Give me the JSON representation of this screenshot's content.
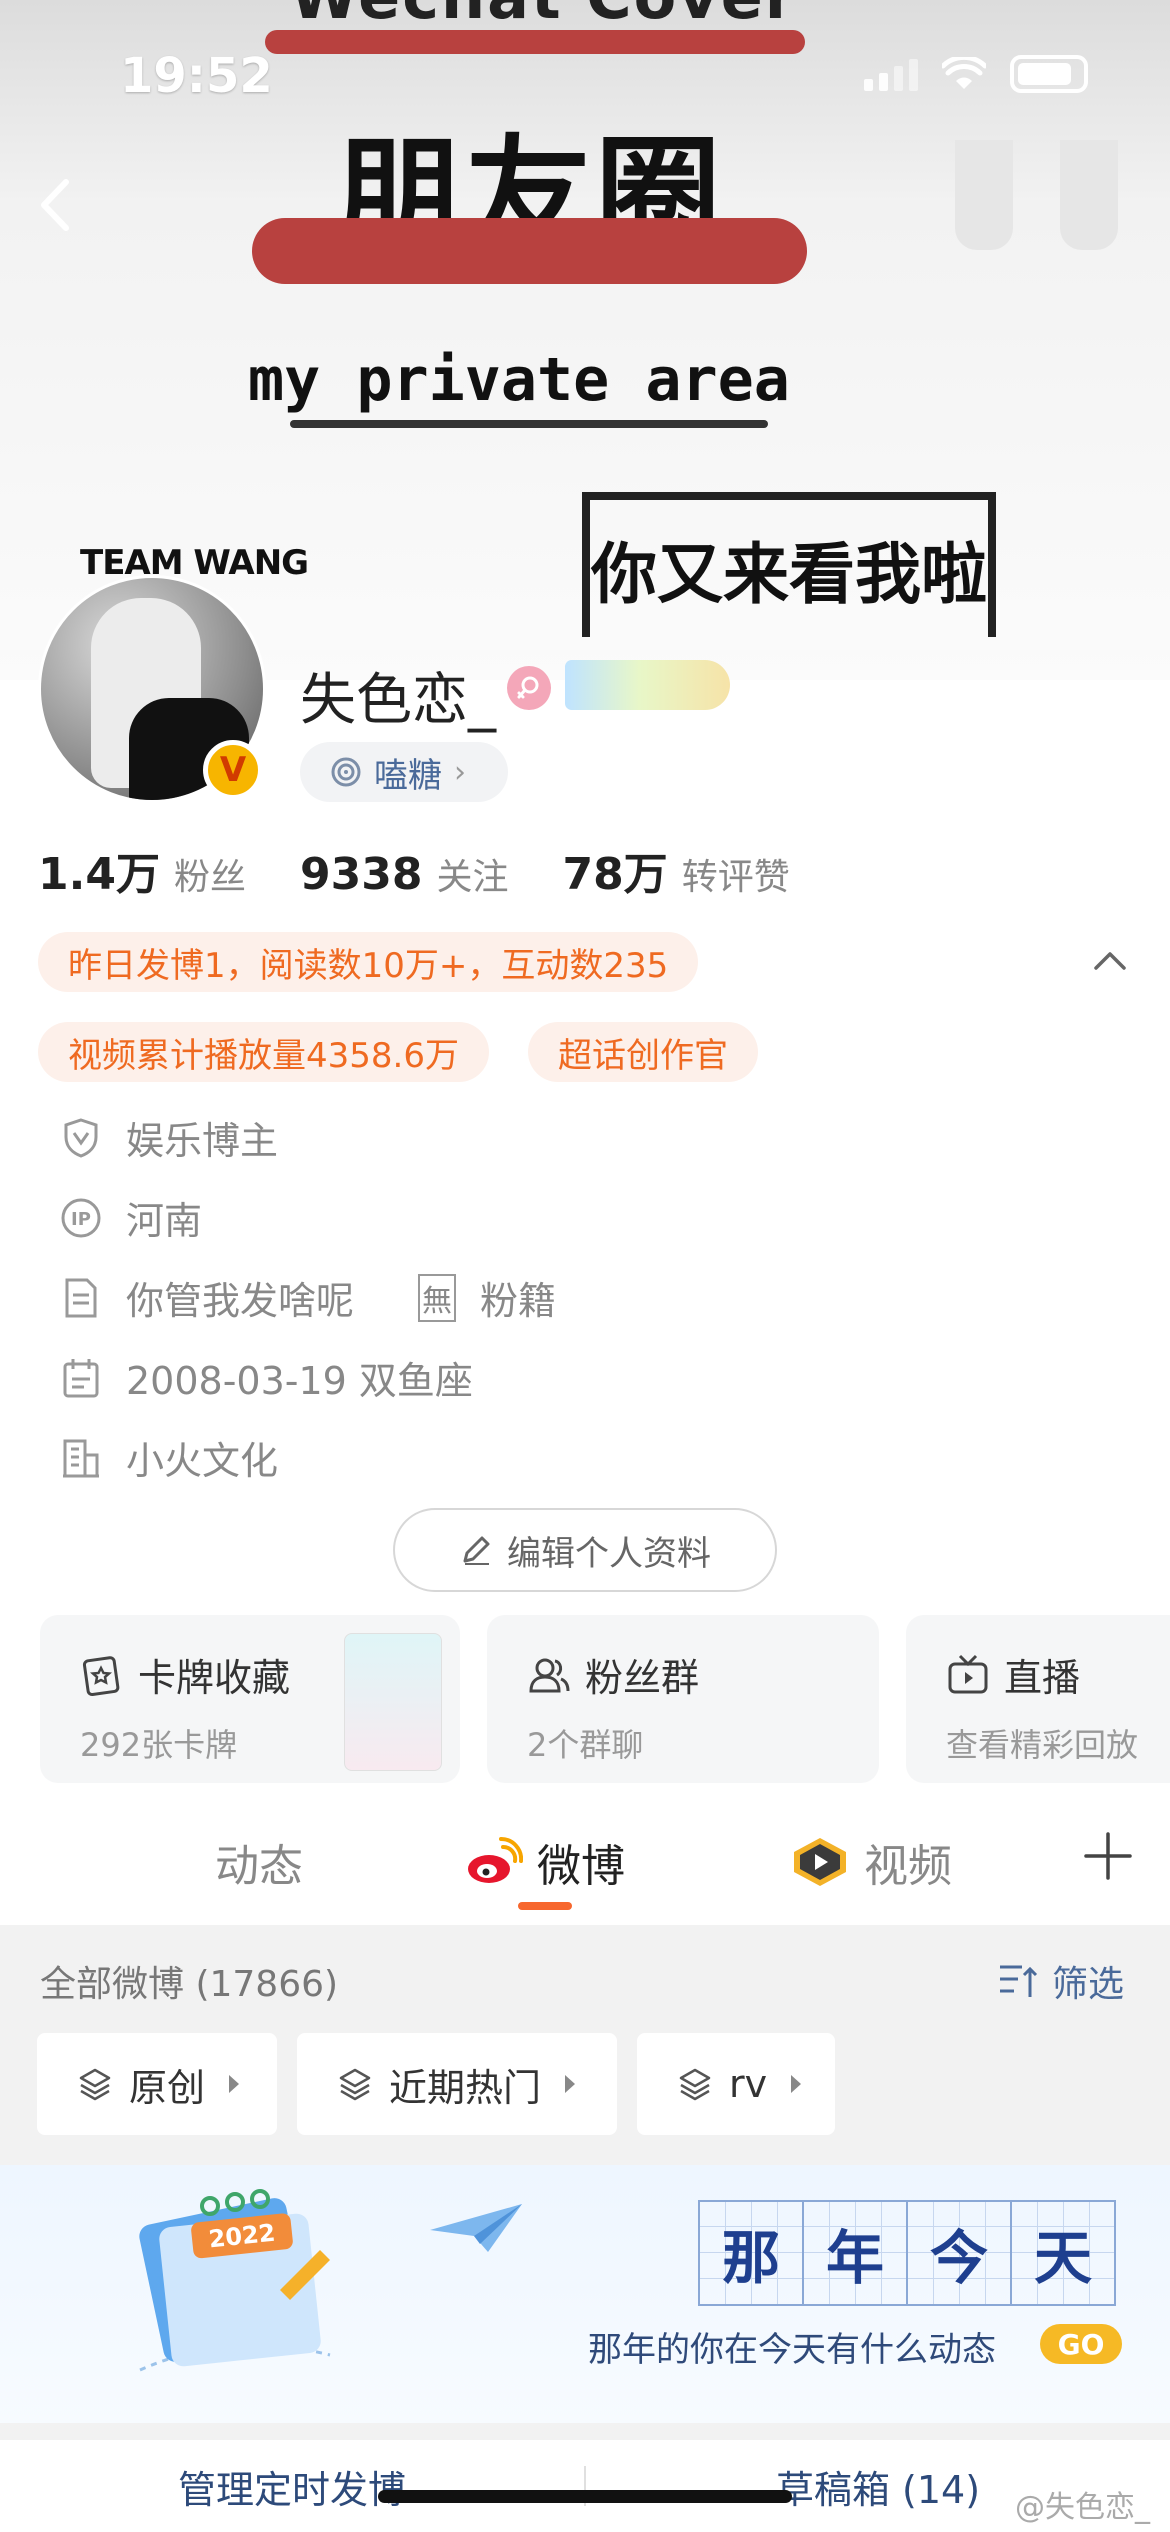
{
  "status_bar": {
    "time": "19:52"
  },
  "cover": {
    "top_text": "Wechat Cover",
    "main_title": "朋友圈",
    "subtitle": "my private area",
    "team_text": "TEAM WANG",
    "box_text": "你又来看我啦"
  },
  "profile": {
    "username": "失色恋_",
    "tag_label": "嗑糖",
    "stats": [
      {
        "number": "1.4万",
        "label": "粉丝"
      },
      {
        "number": "9338",
        "label": "关注"
      },
      {
        "number": "78万",
        "label": "转评赞"
      }
    ],
    "chips": {
      "daily": "昨日发博1，阅读数10万+，互动数235",
      "video_plays": "视频累计播放量4358.6万",
      "super_topic": "超话创作官"
    },
    "info": {
      "role": "娱乐博主",
      "location": "河南",
      "bio": "你管我发啥呢",
      "fan_badge": "無",
      "fan_label": "粉籍",
      "birthday": "2008-03-19 双鱼座",
      "company": "小火文化"
    },
    "edit_button": "编辑个人资料"
  },
  "cards": [
    {
      "title": "卡牌收藏",
      "subtitle": "292张卡牌"
    },
    {
      "title": "粉丝群",
      "subtitle": "2个群聊"
    },
    {
      "title": "直播",
      "subtitle": "查看精彩回放"
    }
  ],
  "tabs": [
    {
      "label": "动态"
    },
    {
      "label": "微博"
    },
    {
      "label": "视频"
    }
  ],
  "feed": {
    "all_label": "全部微博 (17866)",
    "filter_label": "筛选",
    "filters": [
      "原创",
      "近期热门",
      "rv"
    ]
  },
  "banner": {
    "chars": [
      "那",
      "年",
      "今",
      "天"
    ],
    "subtitle": "那年的你在今天有什么动态",
    "go_label": "GO",
    "calendar_year": "2022"
  },
  "bottom": {
    "scheduled": "管理定时发博",
    "drafts": "草稿箱 (14)"
  },
  "watermark": "@失色恋_",
  "colors": {
    "accent": "#f7672e",
    "link": "#4a6a9a",
    "chip_bg": "#fdf0ea",
    "chip_text": "#ef6a21"
  }
}
